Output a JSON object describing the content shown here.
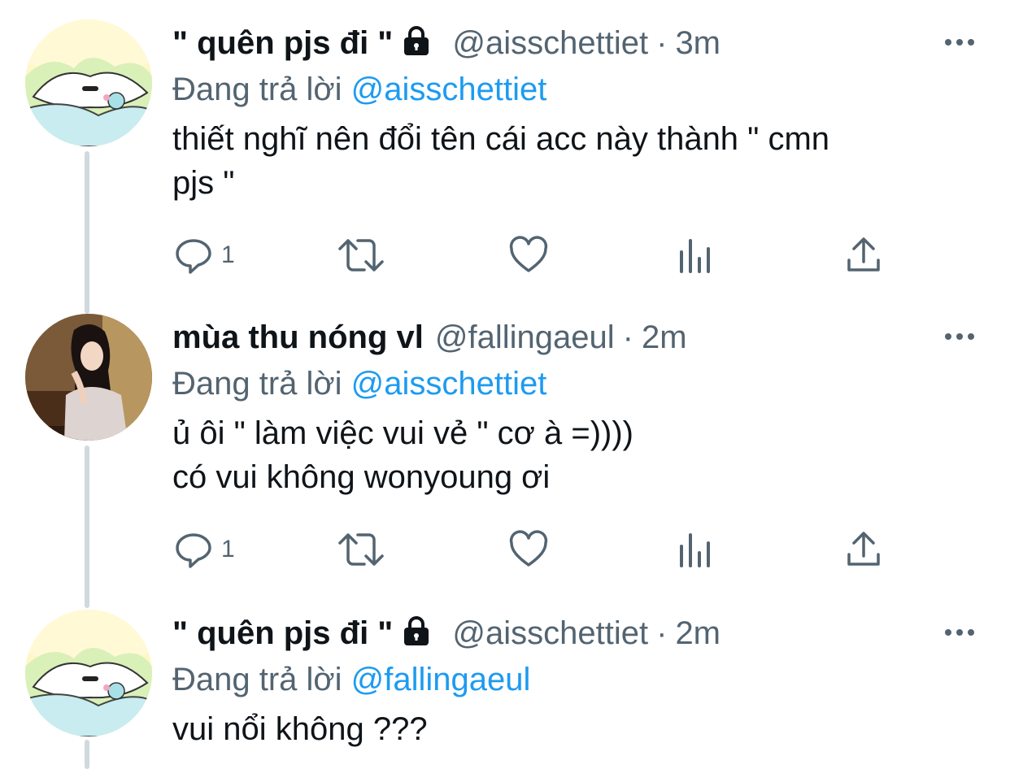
{
  "colors": {
    "text": "#0f1419",
    "secondary": "#536471",
    "link": "#1d9bf0",
    "thread_line": "#cfd9de"
  },
  "tweets": [
    {
      "name": "\" quên pjs đi \"",
      "protected": true,
      "handle": "@aisschettiet",
      "dot": "·",
      "time": "3m",
      "reply_prefix": "Đang trả lời",
      "reply_mention": "@aisschettiet",
      "text_lines": [
        "thiết nghĩ nên đổi tên cái acc này thành \" cmn",
        "pjs \""
      ],
      "reply_count": "1",
      "icons": [
        "reply-icon",
        "retweet-icon",
        "like-icon",
        "analytics-icon",
        "share-icon"
      ]
    },
    {
      "name": "mùa thu nóng vl",
      "protected": false,
      "handle": "@fallingaeul",
      "dot": "·",
      "time": "2m",
      "reply_prefix": "Đang trả lời",
      "reply_mention": "@aisschettiet",
      "text_lines": [
        "ủ ôi \" làm việc vui vẻ \" cơ à =))))",
        "có vui không wonyoung ơi"
      ],
      "reply_count": "1",
      "icons": [
        "reply-icon",
        "retweet-icon",
        "like-icon",
        "analytics-icon",
        "share-icon"
      ]
    },
    {
      "name": "\" quên pjs đi \"",
      "protected": true,
      "handle": "@aisschettiet",
      "dot": "·",
      "time": "2m",
      "reply_prefix": "Đang trả lời",
      "reply_mention": "@fallingaeul",
      "text_lines": [
        "vui nổi không ???"
      ]
    }
  ]
}
